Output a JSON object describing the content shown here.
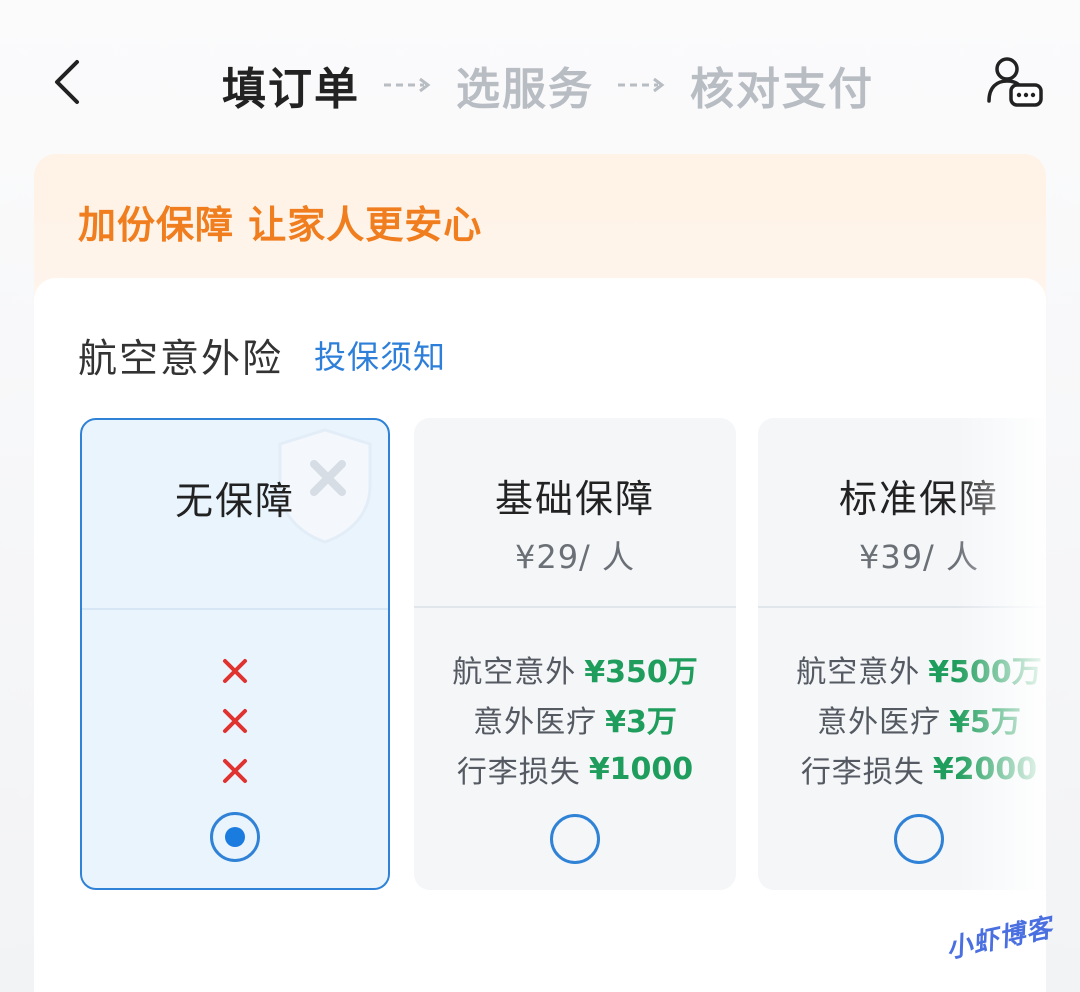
{
  "header": {
    "steps": [
      {
        "label": "填订单",
        "state": "active"
      },
      {
        "label": "选服务",
        "state": "inactive"
      },
      {
        "label": "核对支付",
        "state": "inactive"
      }
    ],
    "back_icon": "chevron-left-icon",
    "service_icon": "customer-service-icon"
  },
  "promo": {
    "text": "加份保障 让家人更安心"
  },
  "insurance": {
    "title": "航空意外险",
    "notice_link": "投保须知",
    "plans": [
      {
        "name": "无保障",
        "price": "",
        "selected": true,
        "coverage": [
          {
            "label": "",
            "value": "",
            "included": false
          },
          {
            "label": "",
            "value": "",
            "included": false
          },
          {
            "label": "",
            "value": "",
            "included": false
          }
        ]
      },
      {
        "name": "基础保障",
        "price": "¥29/ 人",
        "selected": false,
        "coverage": [
          {
            "label": "航空意外",
            "value": "¥350万",
            "included": true
          },
          {
            "label": "意外医疗",
            "value": "¥3万",
            "included": true
          },
          {
            "label": "行李损失",
            "value": "¥1000",
            "included": true
          }
        ]
      },
      {
        "name": "标准保障",
        "price": "¥39/ 人",
        "selected": false,
        "coverage": [
          {
            "label": "航空意外",
            "value": "¥500万",
            "included": true
          },
          {
            "label": "意外医疗",
            "value": "¥5万",
            "included": true
          },
          {
            "label": "行李损失",
            "value": "¥2000",
            "included": true
          }
        ]
      }
    ]
  },
  "colors": {
    "accent_blue": "#2f82d6",
    "promo_orange": "#f07d1e",
    "coverage_green": "#1f9d5c",
    "cross_red": "#e0322f"
  },
  "watermark": "小虾博客"
}
